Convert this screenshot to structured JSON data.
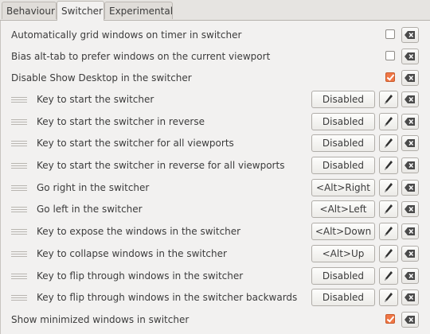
{
  "tabs": [
    {
      "label": "Behaviour",
      "active": false
    },
    {
      "label": "Switcher",
      "active": true
    },
    {
      "label": "Experimental",
      "active": false
    }
  ],
  "settings": [
    {
      "type": "toggle",
      "label": "Automatically grid windows on timer in switcher",
      "checked": false
    },
    {
      "type": "toggle",
      "label": "Bias alt-tab to prefer windows on the current viewport",
      "checked": false
    },
    {
      "type": "toggle",
      "label": "Disable Show Desktop in the switcher",
      "checked": true
    },
    {
      "type": "key",
      "label": "Key to start the switcher",
      "value": "Disabled"
    },
    {
      "type": "key",
      "label": "Key to start the switcher in reverse",
      "value": "Disabled"
    },
    {
      "type": "key",
      "label": "Key to start the switcher for all viewports",
      "value": "Disabled"
    },
    {
      "type": "key",
      "label": "Key to start the switcher in reverse for all viewports",
      "value": "Disabled"
    },
    {
      "type": "key",
      "label": "Go right in the switcher",
      "value": "<Alt>Right"
    },
    {
      "type": "key",
      "label": "Go left in the switcher",
      "value": "<Alt>Left"
    },
    {
      "type": "key",
      "label": "Key to expose the windows in the switcher",
      "value": "<Alt>Down"
    },
    {
      "type": "key",
      "label": "Key to collapse windows in the switcher",
      "value": "<Alt>Up"
    },
    {
      "type": "key",
      "label": "Key to flip through windows in the switcher",
      "value": "Disabled"
    },
    {
      "type": "key",
      "label": "Key to flip through windows in the switcher backwards",
      "value": "Disabled"
    },
    {
      "type": "toggle",
      "label": "Show minimized windows in switcher",
      "checked": true
    }
  ],
  "icons": {
    "edit": "pencil-icon",
    "clear": "clear-backspace-icon",
    "handle": "drag-handle-icon"
  },
  "colors": {
    "accent": "#f07746",
    "background": "#f2f1f0"
  }
}
